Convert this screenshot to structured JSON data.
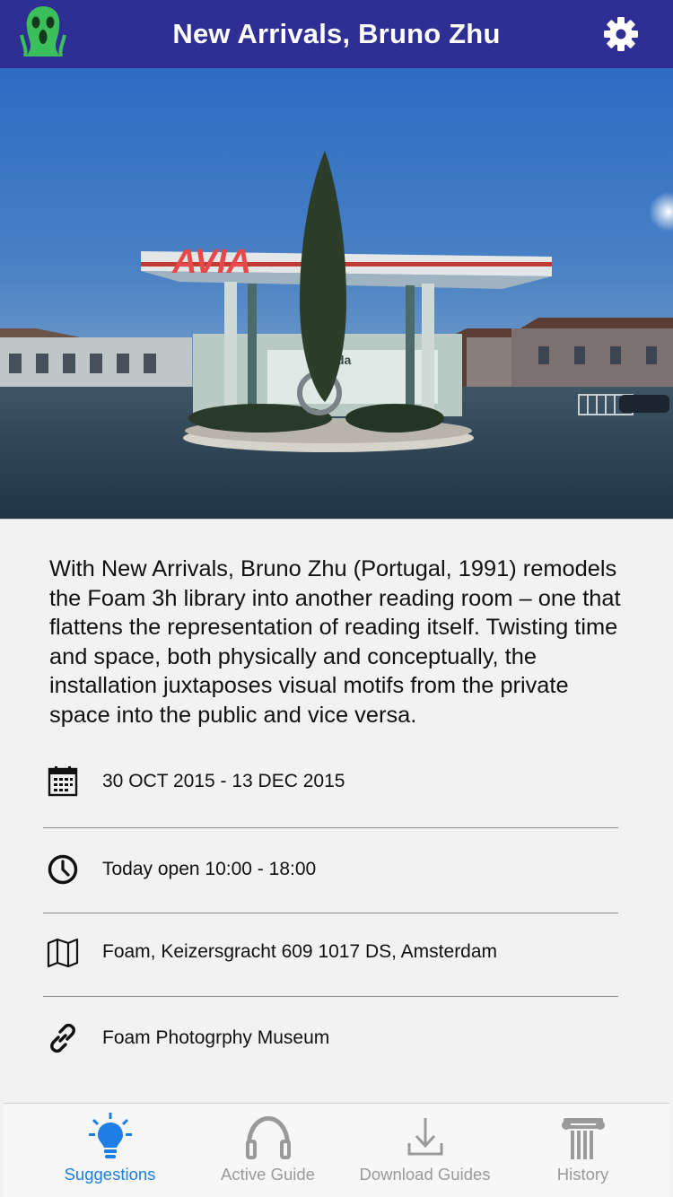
{
  "header": {
    "title": "New Arrivals, Bruno Zhu",
    "logo_icon": "scream-face-icon",
    "settings_icon": "gear-icon"
  },
  "hero": {
    "sign_text": "AVIA",
    "store_text": "da"
  },
  "description": "With New Arrivals, Bruno Zhu (Portugal, 1991) remodels the Foam 3h library into another reading room – one that flattens the representation of reading itself. Twisting time and space, both physically and conceptually, the installation juxtaposes visual motifs from the private space into the public and vice versa.",
  "info": {
    "dates": {
      "icon": "calendar-icon",
      "text": "30 OCT 2015 - 13 DEC 2015"
    },
    "hours": {
      "icon": "clock-icon",
      "text": "Today open 10:00 - 18:00"
    },
    "address": {
      "icon": "map-icon",
      "text": "Foam, Keizersgracht 609 1017 DS, Amsterdam"
    },
    "website": {
      "icon": "link-icon",
      "text": "Foam Photogrphy Museum"
    }
  },
  "tabs": [
    {
      "label": "Suggestions",
      "icon": "lightbulb-icon",
      "active": true
    },
    {
      "label": "Active Guide",
      "icon": "headphones-icon",
      "active": false
    },
    {
      "label": "Download Guides",
      "icon": "download-icon",
      "active": false
    },
    {
      "label": "History",
      "icon": "column-icon",
      "active": false
    }
  ],
  "colors": {
    "header_bg": "#2e2e94",
    "logo_green": "#3bbf5a",
    "active_tab": "#1e7ee6",
    "inactive_tab": "#9a9a9a"
  }
}
